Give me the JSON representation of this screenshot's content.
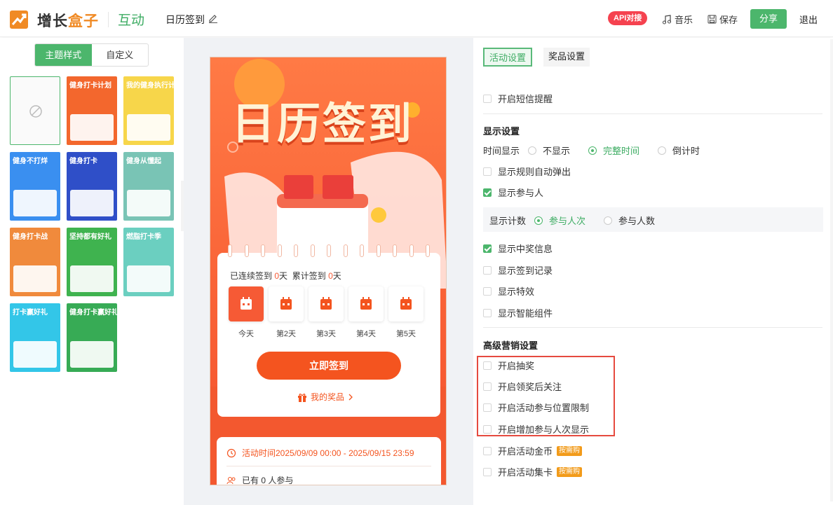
{
  "header": {
    "brand_part1": "增长",
    "brand_part2": "盒子",
    "module": "互动",
    "doc_title": "日历签到",
    "api_badge": "API对接",
    "music": "音乐",
    "save": "保存",
    "share": "分享",
    "exit": "退出",
    "colors": {
      "accent": "#4cb66c",
      "brand_orange": "#f08a24",
      "api_red": "#f5424f"
    }
  },
  "left": {
    "tabs": [
      "主题样式",
      "自定义"
    ],
    "active_tab": 0,
    "themes": [
      {
        "title": "",
        "bg": "#fafafa",
        "kind": "none"
      },
      {
        "title": "健身打卡计划",
        "bg": "#f3672d"
      },
      {
        "title": "我的健身执行计划",
        "bg": "#f7d64a"
      },
      {
        "title": "健身不打烊",
        "bg": "#3a8ff0"
      },
      {
        "title": "健身打卡",
        "bg": "#2f4fc8"
      },
      {
        "title": "健身从懂起",
        "bg": "#79c4b5"
      },
      {
        "title": "健身打卡战",
        "bg": "#f08a3c"
      },
      {
        "title": "坚持都有好礼",
        "bg": "#3fb34f"
      },
      {
        "title": "燃脂打卡季",
        "bg": "#6bcfc0"
      },
      {
        "title": "打卡赢好礼",
        "bg": "#33c6e8"
      },
      {
        "title": "健身打卡赢好礼",
        "bg": "#37ab55"
      }
    ]
  },
  "preview": {
    "hero_title": "日历签到",
    "streak_prefix": "已连续签到",
    "streak_days": "0",
    "streak_unit": "天",
    "total_prefix": "累计签到",
    "total_days": "0",
    "total_unit": "天",
    "days": [
      "今天",
      "第2天",
      "第3天",
      "第4天",
      "第5天"
    ],
    "sign_button": "立即签到",
    "my_prize": "我的奖品",
    "activity_time": "活动时间2025/09/09 00:00 - 2025/09/15 23:59",
    "participants_prefix": "已有",
    "participants_count": "0",
    "participants_suffix": "人参与",
    "colors": {
      "primary": "#f65a35",
      "button": "#f4541f"
    }
  },
  "right": {
    "tabs": [
      "活动设置",
      "奖品设置"
    ],
    "sms_reminder": "开启短信提醒",
    "display_section": "显示设置",
    "time_display_label": "时间显示",
    "time_options": [
      "不显示",
      "完整时间",
      "倒计时"
    ],
    "time_selected": 1,
    "show_rules_popup": "显示规则自动弹出",
    "show_participants": "显示参与人",
    "count_label": "显示计数",
    "count_options": [
      "参与人次",
      "参与人数"
    ],
    "count_selected": 0,
    "show_win_info": "显示中奖信息",
    "show_sign_record": "显示签到记录",
    "show_effects": "显示特效",
    "show_smart_widget": "显示智能组件",
    "advanced_section": "高级营销设置",
    "enable_lottery": "开启抽奖",
    "follow_after_prize": "开启领奖后关注",
    "location_limit": "开启活动参与位置限制",
    "add_participant_display": "开启增加参与人次显示",
    "enable_coins": "开启活动金币",
    "enable_cards": "开启活动集卡",
    "paid_tag": "按需购"
  }
}
